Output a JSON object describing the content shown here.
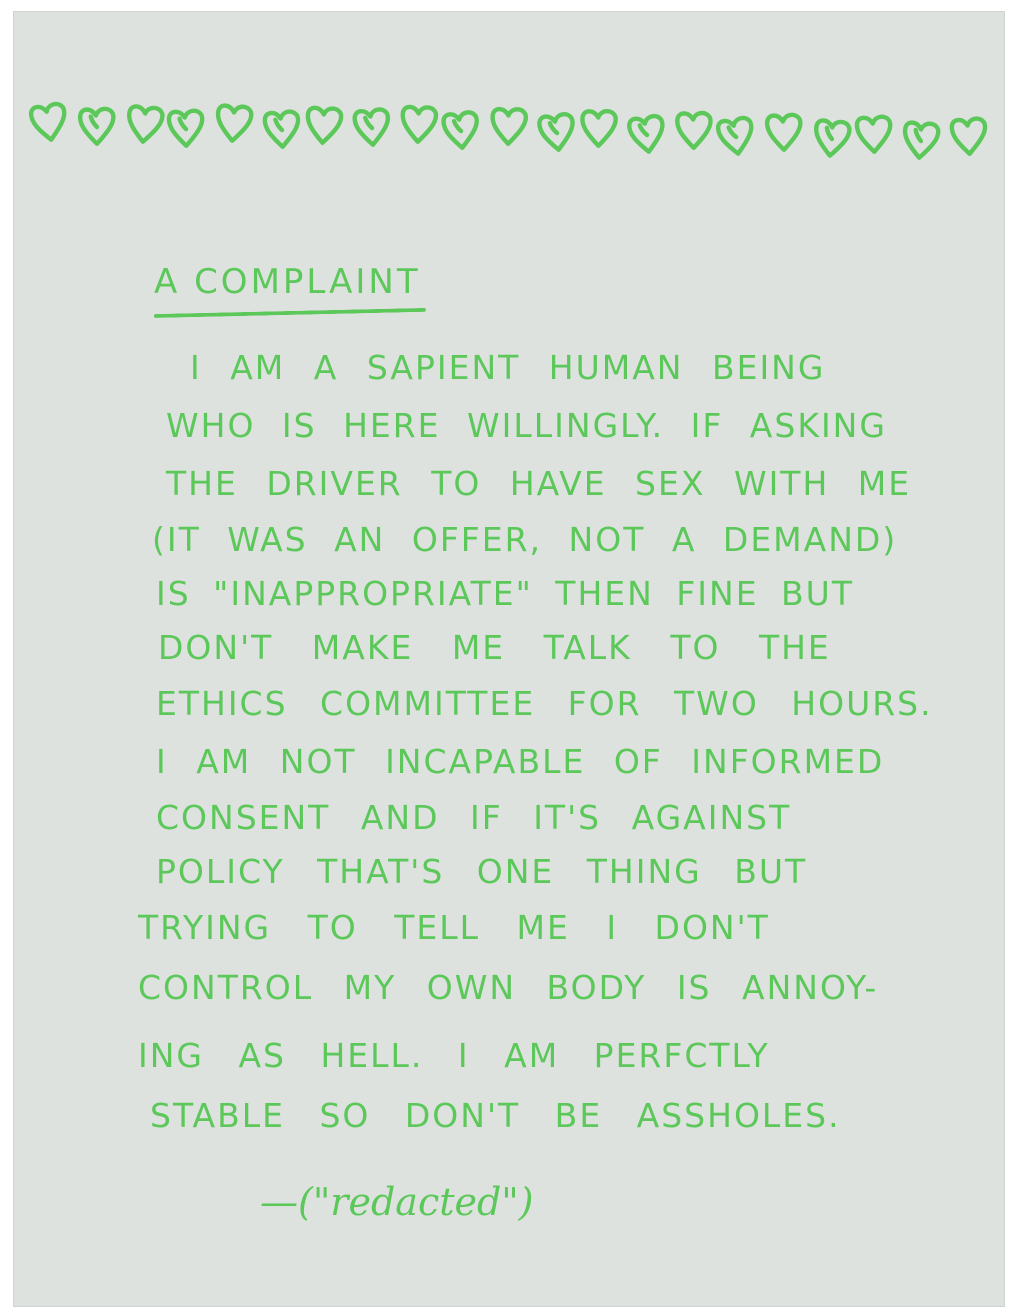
{
  "decoration": {
    "heart_count": 21,
    "ink_color": "#5cc85a",
    "paper_color": "#dde2df"
  },
  "note": {
    "title": "A COMPLAINT",
    "lines": [
      "I AM A SAPIENT HUMAN BEING",
      "WHO IS HERE WILLINGLY. IF ASKING",
      "THE DRIVER TO HAVE SEX WITH ME",
      "(IT WAS AN OFFER, NOT A DEMAND)",
      "IS \"INAPPROPRIATE\" THEN FINE BUT",
      "DON'T MAKE ME TALK TO THE",
      "ETHICS COMMITTEE FOR TWO HOURS.",
      "I AM NOT INCAPABLE OF INFORMED",
      "CONSENT AND IF IT'S AGAINST",
      "POLICY THAT'S ONE THING BUT",
      "TRYING TO TELL ME I DON'T",
      "CONTROL MY OWN BODY IS ANNOY-",
      "ING AS HELL. I AM PERFCTLY",
      "STABLE SO DON'T BE ASSHOLES."
    ],
    "signature": "—(\"redacted\")"
  }
}
